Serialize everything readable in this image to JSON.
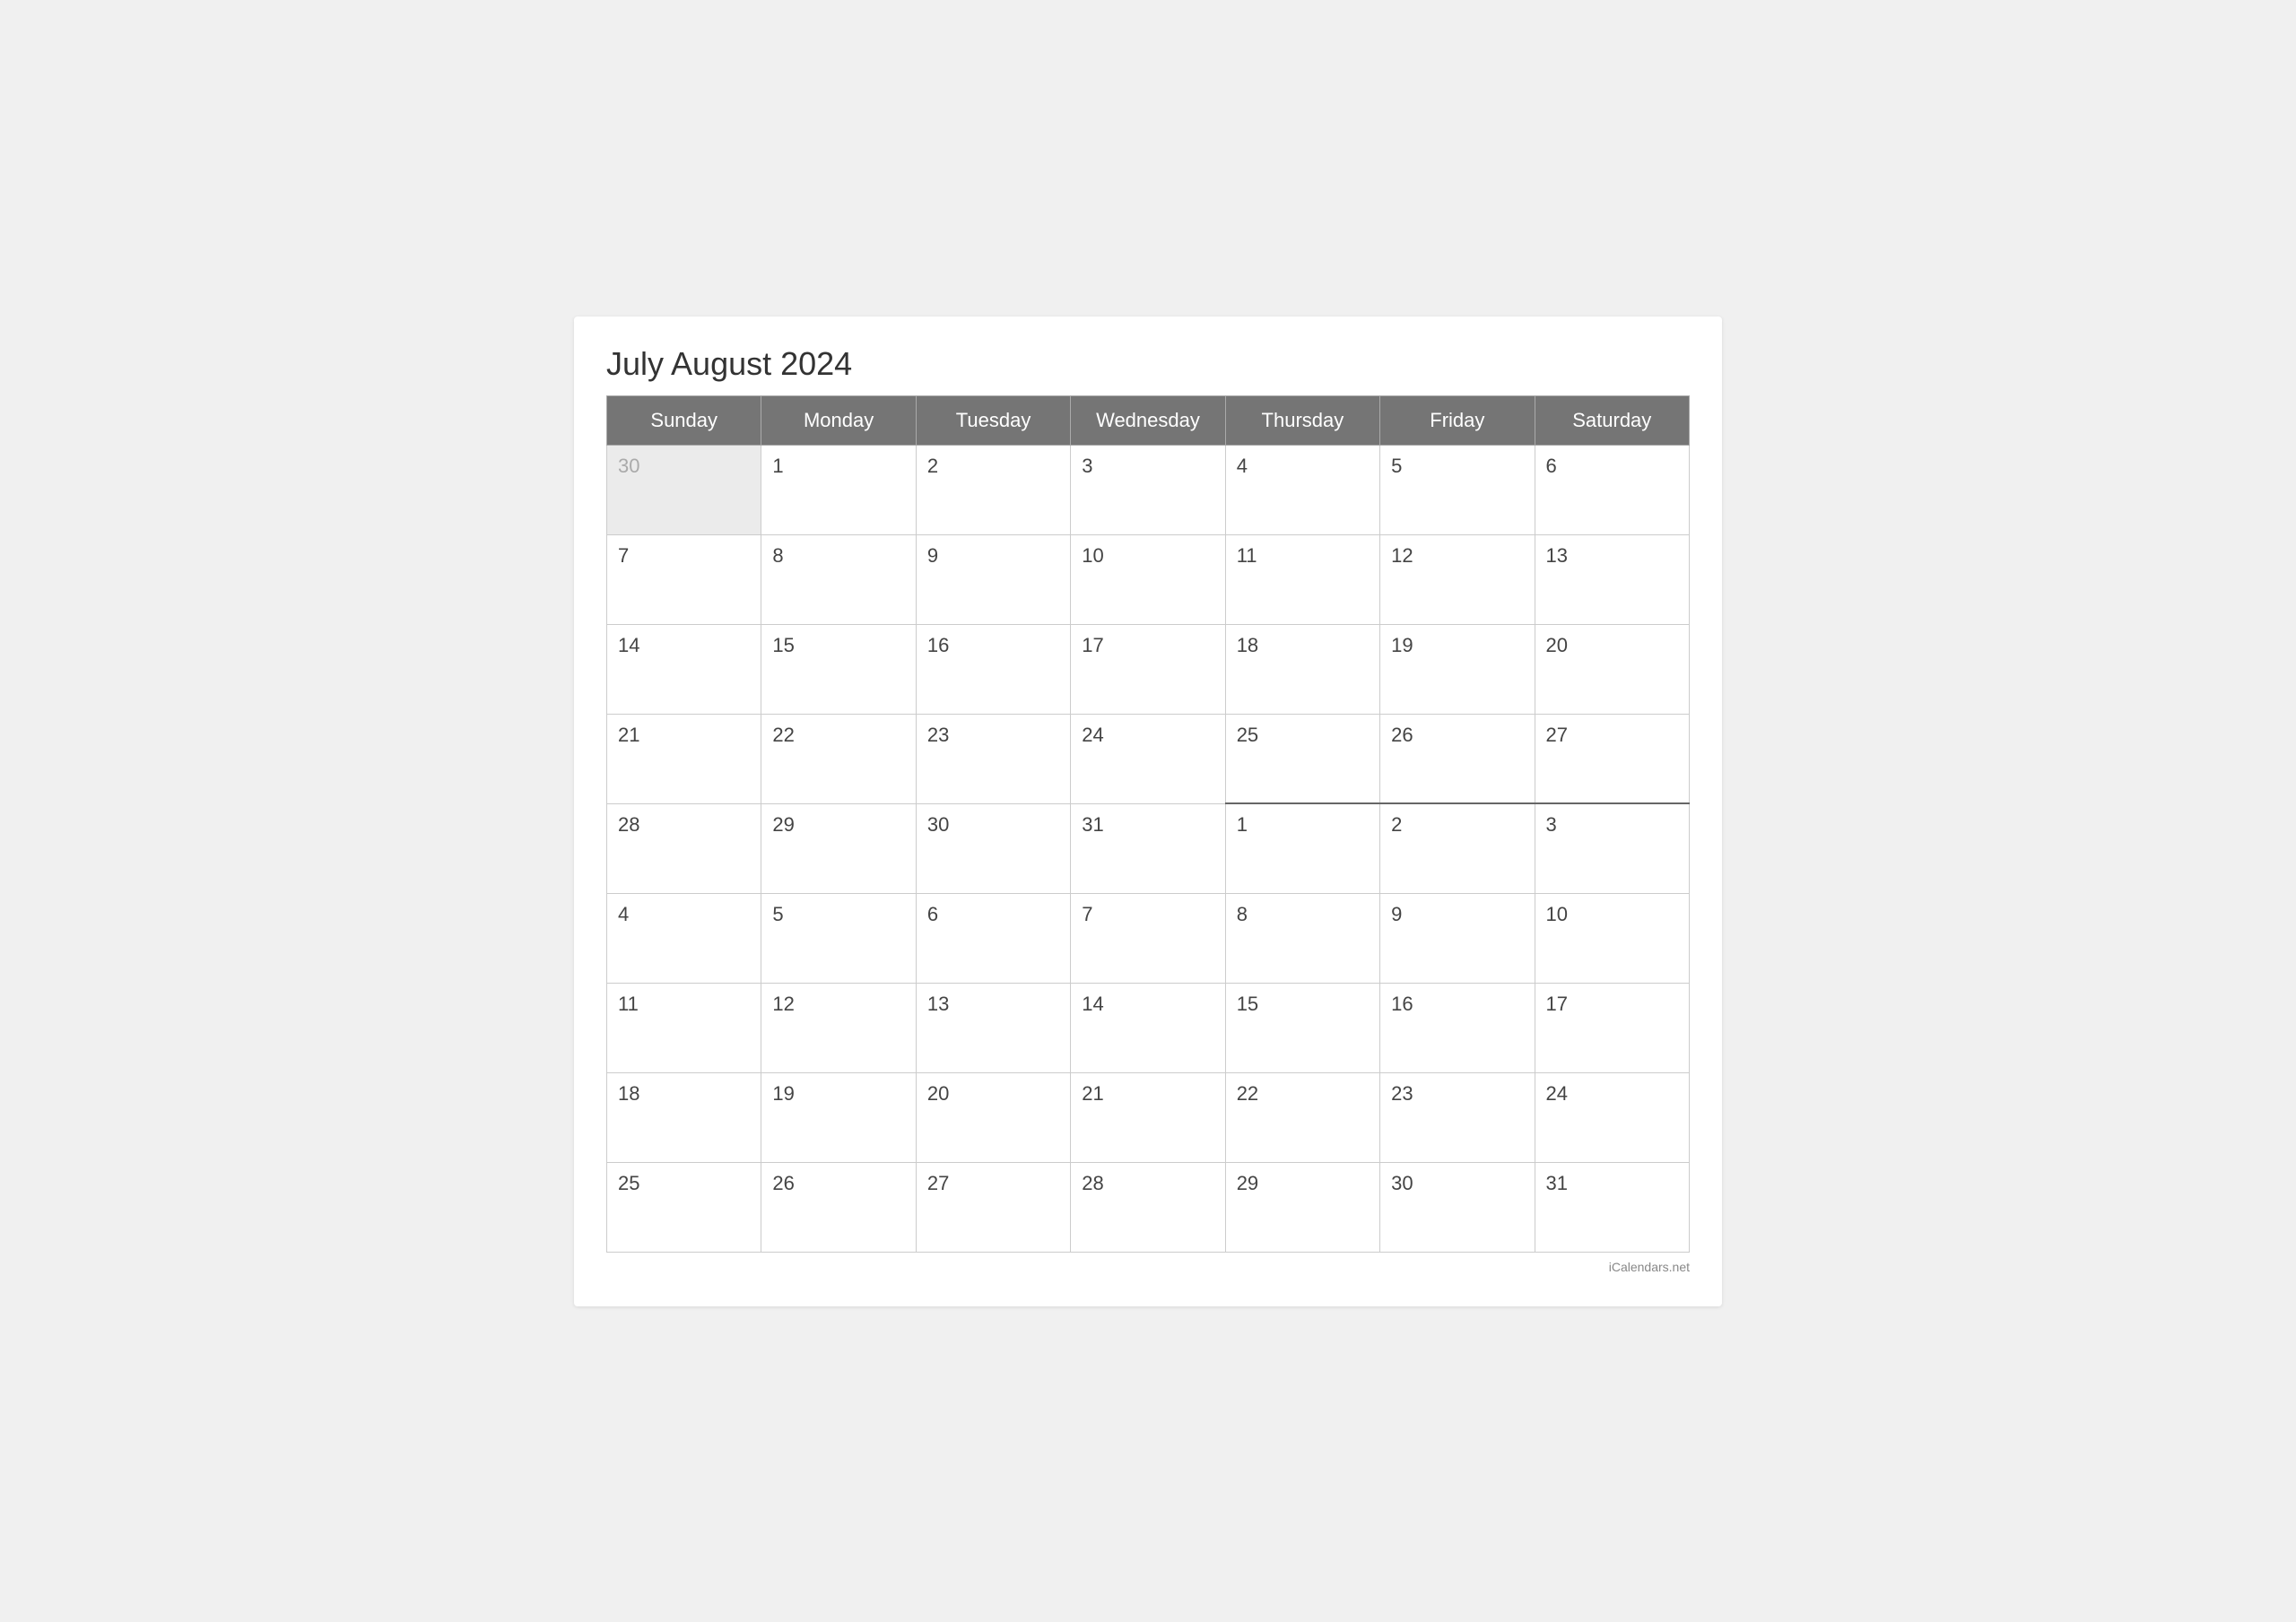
{
  "calendar": {
    "title": "July August 2024",
    "headers": [
      "Sunday",
      "Monday",
      "Tuesday",
      "Wednesday",
      "Thursday",
      "Friday",
      "Saturday"
    ],
    "rows": [
      [
        {
          "day": "30",
          "type": "prev-month"
        },
        {
          "day": "1",
          "type": "current"
        },
        {
          "day": "2",
          "type": "current"
        },
        {
          "day": "3",
          "type": "current"
        },
        {
          "day": "4",
          "type": "current"
        },
        {
          "day": "5",
          "type": "current"
        },
        {
          "day": "6",
          "type": "current"
        }
      ],
      [
        {
          "day": "7",
          "type": "current"
        },
        {
          "day": "8",
          "type": "current"
        },
        {
          "day": "9",
          "type": "current"
        },
        {
          "day": "10",
          "type": "current"
        },
        {
          "day": "11",
          "type": "current"
        },
        {
          "day": "12",
          "type": "current"
        },
        {
          "day": "13",
          "type": "current"
        }
      ],
      [
        {
          "day": "14",
          "type": "current"
        },
        {
          "day": "15",
          "type": "current"
        },
        {
          "day": "16",
          "type": "current"
        },
        {
          "day": "17",
          "type": "current"
        },
        {
          "day": "18",
          "type": "current"
        },
        {
          "day": "19",
          "type": "current"
        },
        {
          "day": "20",
          "type": "current"
        }
      ],
      [
        {
          "day": "21",
          "type": "current"
        },
        {
          "day": "22",
          "type": "current"
        },
        {
          "day": "23",
          "type": "current"
        },
        {
          "day": "24",
          "type": "current"
        },
        {
          "day": "25",
          "type": "current"
        },
        {
          "day": "26",
          "type": "current"
        },
        {
          "day": "27",
          "type": "current"
        }
      ],
      [
        {
          "day": "28",
          "type": "current"
        },
        {
          "day": "29",
          "type": "current"
        },
        {
          "day": "30",
          "type": "current"
        },
        {
          "day": "31",
          "type": "current"
        },
        {
          "day": "1",
          "type": "next-month transition"
        },
        {
          "day": "2",
          "type": "next-month transition"
        },
        {
          "day": "3",
          "type": "next-month transition"
        }
      ],
      [
        {
          "day": "4",
          "type": "next-month"
        },
        {
          "day": "5",
          "type": "next-month"
        },
        {
          "day": "6",
          "type": "next-month"
        },
        {
          "day": "7",
          "type": "next-month"
        },
        {
          "day": "8",
          "type": "next-month"
        },
        {
          "day": "9",
          "type": "next-month"
        },
        {
          "day": "10",
          "type": "next-month"
        }
      ],
      [
        {
          "day": "11",
          "type": "next-month"
        },
        {
          "day": "12",
          "type": "next-month"
        },
        {
          "day": "13",
          "type": "next-month"
        },
        {
          "day": "14",
          "type": "next-month"
        },
        {
          "day": "15",
          "type": "next-month"
        },
        {
          "day": "16",
          "type": "next-month"
        },
        {
          "day": "17",
          "type": "next-month"
        }
      ],
      [
        {
          "day": "18",
          "type": "next-month"
        },
        {
          "day": "19",
          "type": "next-month"
        },
        {
          "day": "20",
          "type": "next-month"
        },
        {
          "day": "21",
          "type": "next-month"
        },
        {
          "day": "22",
          "type": "next-month"
        },
        {
          "day": "23",
          "type": "next-month"
        },
        {
          "day": "24",
          "type": "next-month"
        }
      ],
      [
        {
          "day": "25",
          "type": "next-month"
        },
        {
          "day": "26",
          "type": "next-month"
        },
        {
          "day": "27",
          "type": "next-month"
        },
        {
          "day": "28",
          "type": "next-month"
        },
        {
          "day": "29",
          "type": "next-month"
        },
        {
          "day": "30",
          "type": "next-month"
        },
        {
          "day": "31",
          "type": "next-month"
        }
      ]
    ],
    "footer": "iCalendars.net"
  }
}
